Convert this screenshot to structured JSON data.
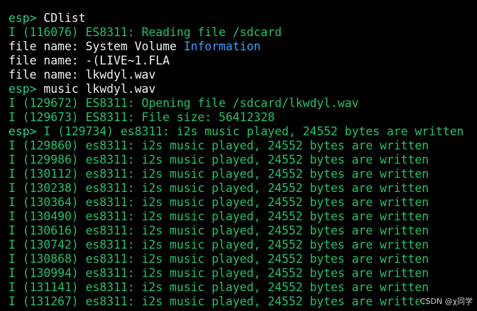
{
  "colors": {
    "background": "#000000",
    "prompt_green": "#23d18b",
    "log_green": "#23c26b",
    "plain_text": "#f2f2f2",
    "highlight_blue": "#3aa0ff"
  },
  "terminal": {
    "lines": [
      {
        "prompt": "esp> ",
        "text": "CDlist"
      },
      {
        "log": "I (116076) ES8311: Reading file /sdcard"
      },
      {
        "text": "file name: System Volume ",
        "highlight": "Information"
      },
      {
        "text": "file name: -(LIVE~1.FLA"
      },
      {
        "text": "file name: lkwdyl.wav"
      },
      {
        "prompt": "esp> ",
        "text": "music lkwdyl.wav"
      },
      {
        "log": "I (129672) ES8311: Opening file /sdcard/lkwdyl.wav"
      },
      {
        "log": "I (129673) ES8311: File size: 56412328"
      },
      {
        "prompt": "esp> ",
        "log": "I (129734) es8311: i2s music played, 24552 bytes are written"
      },
      {
        "log": "I (129860) es8311: i2s music played, 24552 bytes are written"
      },
      {
        "log": "I (129986) es8311: i2s music played, 24552 bytes are written"
      },
      {
        "log": "I (130112) es8311: i2s music played, 24552 bytes are written"
      },
      {
        "log": "I (130238) es8311: i2s music played, 24552 bytes are written"
      },
      {
        "log": "I (130364) es8311: i2s music played, 24552 bytes are written"
      },
      {
        "log": "I (130490) es8311: i2s music played, 24552 bytes are written"
      },
      {
        "log": "I (130616) es8311: i2s music played, 24552 bytes are written"
      },
      {
        "log": "I (130742) es8311: i2s music played, 24552 bytes are written"
      },
      {
        "log": "I (130868) es8311: i2s music played, 24552 bytes are written"
      },
      {
        "log": "I (130994) es8311: i2s music played, 24552 bytes are written"
      },
      {
        "log": "I (131141) es8311: i2s music played, 24552 bytes are written"
      },
      {
        "log": "I (131267) es8311: i2s music played, 24552 bytes are written"
      }
    ]
  },
  "watermark": "CSDN @χ同学"
}
